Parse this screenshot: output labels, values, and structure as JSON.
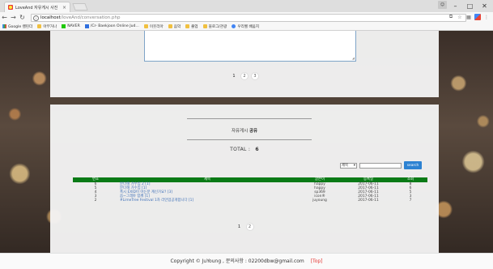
{
  "browser": {
    "tab_title": "LoveAnd 자유게시 사진",
    "tab_close": "×",
    "url_host": "localhost",
    "url_path": "/loveAnd/conversation.php",
    "minimize": "–",
    "maximize": "□",
    "close": "✕",
    "bookmarks": [
      {
        "label": "Google 캘린더",
        "icon": "apps"
      },
      {
        "label": "아무거나",
        "icon": "folder"
      },
      {
        "label": "NAVER",
        "icon": "naver"
      },
      {
        "label": "/Cr- Baekjoon Online Jud...",
        "icon": "blue"
      },
      {
        "label": "이웃리아",
        "icon": "folder"
      },
      {
        "label": "음악",
        "icon": "folder"
      },
      {
        "label": "졸업",
        "icon": "folder"
      },
      {
        "label": "블로그/관광",
        "icon": "folder"
      },
      {
        "label": "우리벨 배움지",
        "icon": "google"
      }
    ]
  },
  "top_panel": {
    "pages": [
      "1",
      "2",
      "3"
    ]
  },
  "board": {
    "title_prefix": "자유게시",
    "title_bold": "공유",
    "total_label": "TOTAL :",
    "total_value": "6",
    "search": {
      "select_value": "제목",
      "button_label": "search"
    },
    "columns": [
      "번호",
      "제목",
      "글쓴이",
      "등록일",
      "조회"
    ],
    "rows": [
      [
        "6",
        "분다해 가수입 2 [1]",
        "happy",
        "2017-06-11",
        "8"
      ],
      [
        "5",
        "분다해 가수입 [1]",
        "happy",
        "2017-06-11",
        "6"
      ],
      [
        "4",
        "혹시 EXID이 아는분 계신가요? [3]",
        "sp369",
        "2017-06-11",
        "5"
      ],
      [
        "3",
        "음~그래야 함께 [1]",
        "icon®",
        "2017-06-11",
        "3"
      ],
      [
        "2",
        "#LimeTree Festival 1차 라인업공개합니다 [1]",
        "juyoung",
        "2017-06-11",
        "7"
      ]
    ],
    "pages": [
      "1",
      "2"
    ]
  },
  "footer": {
    "text": "Copyright © JuYoung , 문의사항 : 02200dbw@gmail.com",
    "top_link": "[Top]"
  },
  "colors": {
    "table_header": "#0a7a16",
    "search_button": "#2d82d2",
    "link": "#3f70b8",
    "top_link": "#e53935"
  }
}
